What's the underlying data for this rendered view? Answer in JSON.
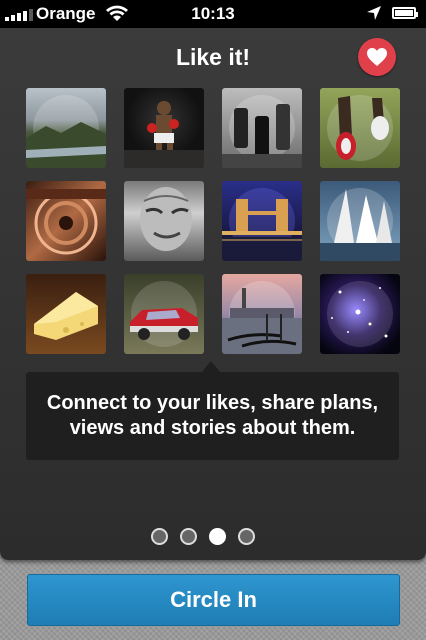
{
  "status_bar": {
    "carrier": "Orange",
    "time": "10:13",
    "icons": [
      "signal-bars-icon",
      "wifi-icon",
      "location-arrow-icon",
      "battery-icon"
    ]
  },
  "header": {
    "title": "Like it!",
    "like_icon": "heart-icon",
    "like_color": "#e0404a"
  },
  "grid": {
    "items": [
      {
        "name": "thumb-landscape",
        "subject": "coastal landscape"
      },
      {
        "name": "thumb-boxer",
        "subject": "boxer"
      },
      {
        "name": "thumb-chess",
        "subject": "chess pieces"
      },
      {
        "name": "thumb-running-shoes",
        "subject": "running shoes"
      },
      {
        "name": "thumb-film-reel",
        "subject": "film reel"
      },
      {
        "name": "thumb-old-man",
        "subject": "old man portrait"
      },
      {
        "name": "thumb-tower-bridge",
        "subject": "tower bridge at night"
      },
      {
        "name": "thumb-sailboats",
        "subject": "sailboats"
      },
      {
        "name": "thumb-cheese",
        "subject": "cheese"
      },
      {
        "name": "thumb-classic-car",
        "subject": "classic car"
      },
      {
        "name": "thumb-venice",
        "subject": "venice gondolas"
      },
      {
        "name": "thumb-galaxy",
        "subject": "star cluster"
      }
    ]
  },
  "callout": {
    "text": "Connect to your likes, share plans, views and stories about them."
  },
  "pager": {
    "count": 4,
    "active_index": 2
  },
  "cta": {
    "label": "Circle In",
    "color": "#2f96cf"
  }
}
